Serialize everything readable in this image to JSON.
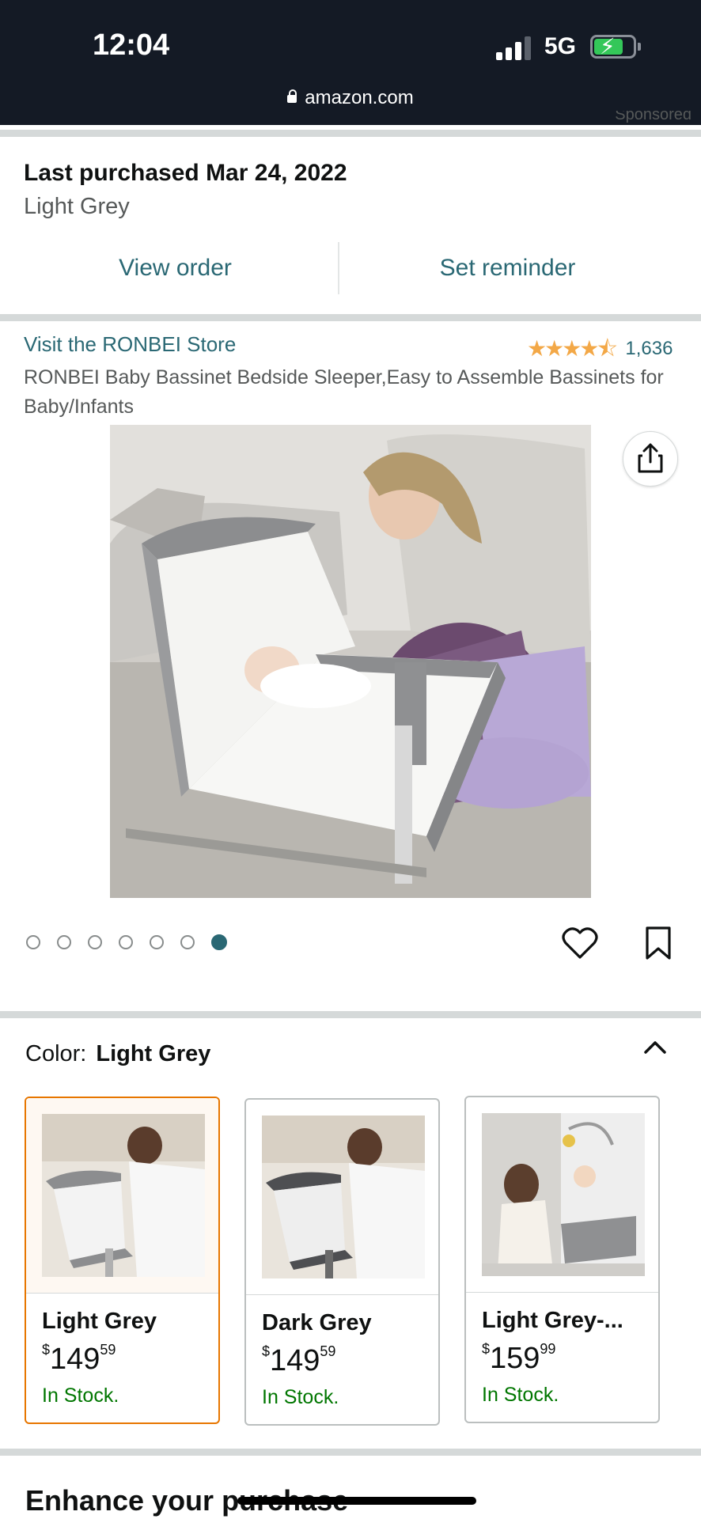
{
  "status_bar": {
    "time": "12:04",
    "network": "5G",
    "url": "amazon.com"
  },
  "sponsored_text": "Sponsored",
  "last_purchased": {
    "title": "Last purchased Mar 24, 2022",
    "variant": "Light Grey",
    "view_order_label": "View order",
    "set_reminder_label": "Set reminder"
  },
  "product": {
    "store_link": "Visit the RONBEI Store",
    "rating": 4.5,
    "stars_text": "★★★★⯪",
    "rating_count": "1,636",
    "title": "RONBEI Baby Bassinet Bedside Sleeper,Easy to Assemble Bassinets for Baby/Infants",
    "image_count": 7,
    "active_image_index": 6
  },
  "color_selector": {
    "label": "Color:",
    "selected": "Light Grey",
    "options": [
      {
        "name": "Light Grey",
        "price_symbol": "$",
        "price_whole": "149",
        "price_fraction": "59",
        "stock": "In Stock."
      },
      {
        "name": "Dark Grey",
        "price_symbol": "$",
        "price_whole": "149",
        "price_fraction": "59",
        "stock": "In Stock."
      },
      {
        "name": "Light Grey-...",
        "price_symbol": "$",
        "price_whole": "159",
        "price_fraction": "99",
        "stock": "In Stock."
      }
    ]
  },
  "enhance_heading": "Enhance your purchase",
  "colors": {
    "link": "#2a6874",
    "star": "#f3a847",
    "in_stock": "#007600",
    "selected_border": "#e77600",
    "status_bar_bg": "#141a25"
  }
}
